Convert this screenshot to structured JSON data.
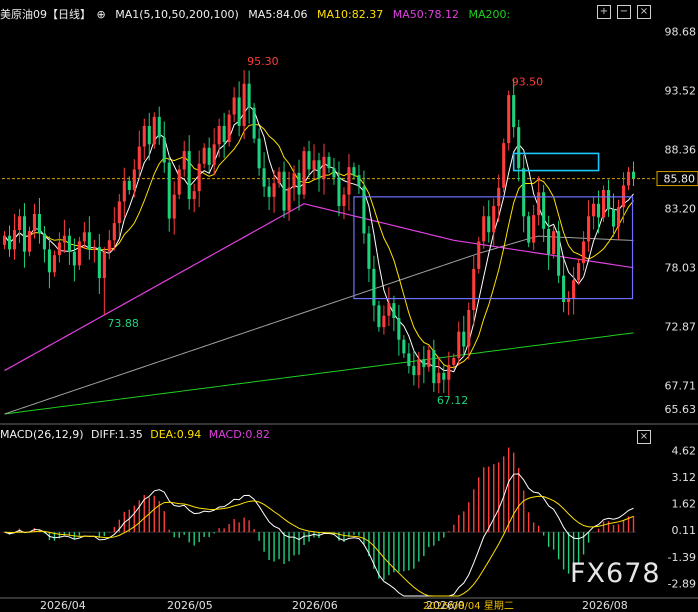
{
  "header": {
    "title": "美原油09【日线】",
    "ma_label": "MA1(5,10,50,200,100)",
    "ma5": "MA5:84.06",
    "ma10": "MA10:82.37",
    "ma50": "MA50:78.12",
    "ma200": "MA200:"
  },
  "macd_header": {
    "label": "MACD(26,12,9)",
    "diff": "DIFF:1.35",
    "dea": "DEA:0.94",
    "macd": "MACD:0.82"
  },
  "watermark": "FX678",
  "cursor_date": "2026/08/04 星期二",
  "colors": {
    "up": "#ff3c3c",
    "down": "#1ed27d",
    "ma5": "#ffffff",
    "ma10": "#ffe000",
    "ma50": "#e040e0",
    "ma100": "#a0a0a0",
    "ma200": "#20d020",
    "box": "#7070ff",
    "box2": "#1ec8ff"
  },
  "chart_data": [
    {
      "type": "candlestick",
      "title": "美原油09【日线】",
      "ylim": [
        64.5,
        99.5
      ],
      "yticks": [
        98.68,
        93.52,
        88.36,
        83.2,
        78.03,
        72.87,
        67.71,
        65.63
      ],
      "xlabels": [
        "2026/04",
        "2026/05",
        "2026/06",
        "2026/0",
        "2026/08"
      ],
      "last_price": 85.8,
      "annotations": [
        {
          "text": "95.30",
          "value": 95.3,
          "color": "up"
        },
        {
          "text": "93.50",
          "value": 93.5,
          "color": "up"
        },
        {
          "text": "73.88",
          "value": 73.88,
          "color": "down"
        },
        {
          "text": "67.12",
          "value": 67.12,
          "color": "down"
        }
      ],
      "closes": [
        80.8,
        79.6,
        81.3,
        82.5,
        79.4,
        81.2,
        82.7,
        81.0,
        79.6,
        77.6,
        79.1,
        80.2,
        80.8,
        79.4,
        78.2,
        80.3,
        81.1,
        79.6,
        79.8,
        77.1,
        79.4,
        80.4,
        81.9,
        83.8,
        85.6,
        84.8,
        86.6,
        88.6,
        90.4,
        88.8,
        91.2,
        89.4,
        87.2,
        82.3,
        84.4,
        86.6,
        88.2,
        84.0,
        84.7,
        87.1,
        88.5,
        87.0,
        88.8,
        90.4,
        89.0,
        91.4,
        92.9,
        90.4,
        94.1,
        92.0,
        89.3,
        86.7,
        85.1,
        84.2,
        85.4,
        86.4,
        83.0,
        85.0,
        86.3,
        84.4,
        88.2,
        86.6,
        87.4,
        85.8,
        87.7,
        86.7,
        85.9,
        83.4,
        84.4,
        86.8,
        86.1,
        85.1,
        81.0,
        77.9,
        74.7,
        72.8,
        73.8,
        74.9,
        73.6,
        71.7,
        70.5,
        69.4,
        68.6,
        70.0,
        69.3,
        70.8,
        67.9,
        68.8,
        68.2,
        69.5,
        70.1,
        72.4,
        71.1,
        74.3,
        77.9,
        80.3,
        82.5,
        81.1,
        83.4,
        85.0,
        88.9,
        93.1,
        90.3,
        86.7,
        82.5,
        80.2,
        82.6,
        84.6,
        81.4,
        79.2,
        81.2,
        77.3,
        75.0,
        75.3,
        76.9,
        78.4,
        80.3,
        82.5,
        83.6,
        82.4,
        84.8,
        83.1,
        81.6,
        83.3,
        85.2,
        86.4,
        85.8
      ]
    },
    {
      "type": "bar",
      "title": "MACD(26,12,9)",
      "ylim": [
        -3.6,
        5.2
      ],
      "yticks": [
        4.62,
        3.12,
        1.62,
        0.11,
        -1.39,
        -2.89
      ],
      "series_names": [
        "DIFF",
        "DEA",
        "MACD"
      ],
      "last": {
        "diff": 1.35,
        "dea": 0.94,
        "macd": 0.82
      }
    }
  ]
}
